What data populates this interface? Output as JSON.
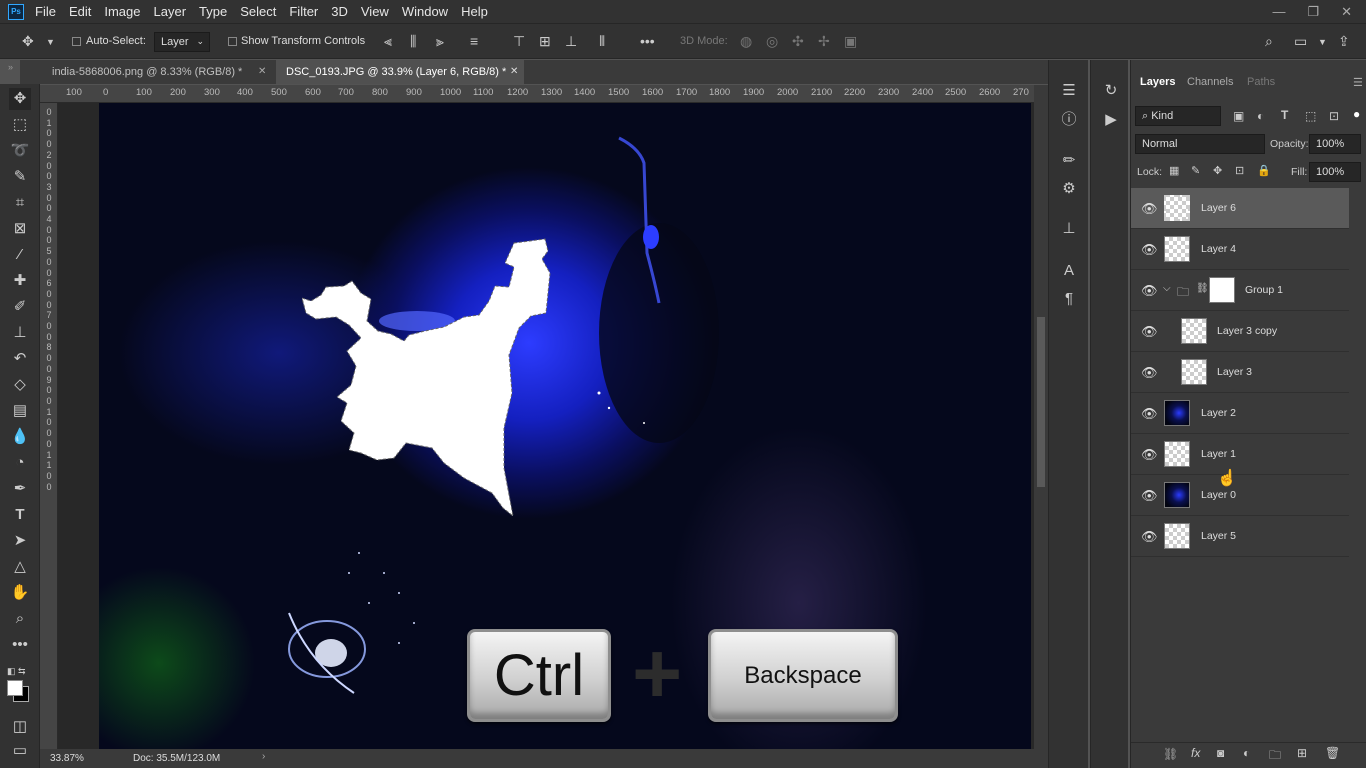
{
  "app": {
    "logo": "Ps"
  },
  "menu": [
    "File",
    "Edit",
    "Image",
    "Layer",
    "Type",
    "Select",
    "Filter",
    "3D",
    "View",
    "Window",
    "Help"
  ],
  "window_controls": {
    "minimize": "—",
    "restore": "❐",
    "close": "✕"
  },
  "options_bar": {
    "auto_select_label": "Auto-Select:",
    "auto_select_value": "Layer",
    "transform_label": "Show Transform Controls",
    "mode_3d_label": "3D Mode:"
  },
  "tabs": [
    {
      "label": "india-5868006.png @ 8.33% (RGB/8) *",
      "active": false
    },
    {
      "label": "DSC_0193.JPG @ 33.9% (Layer 6, RGB/8) *",
      "active": true
    }
  ],
  "ruler_h": [
    "100",
    "0",
    "100",
    "200",
    "300",
    "400",
    "500",
    "600",
    "700",
    "800",
    "900",
    "1000",
    "1100",
    "1200",
    "1300",
    "1400",
    "1500",
    "1600",
    "1700",
    "1800",
    "1900",
    "2000",
    "2100",
    "2200",
    "2300",
    "2400",
    "2500",
    "2600",
    "270"
  ],
  "ruler_v": [
    "0",
    "1",
    "0",
    "0",
    "2",
    "0",
    "0",
    "3",
    "0",
    "0",
    "4",
    "0",
    "0",
    "5",
    "0",
    "0",
    "6",
    "0",
    "0",
    "7",
    "0",
    "0",
    "8",
    "0",
    "0",
    "9",
    "0",
    "0",
    "1",
    "0",
    "0",
    "0",
    "1",
    "1",
    "0",
    "0"
  ],
  "status": {
    "zoom": "33.87%",
    "doc": "Doc: 35.5M/123.0M"
  },
  "panel": {
    "tabs": [
      "Layers",
      "Channels",
      "Paths"
    ],
    "filter_kind": "Kind",
    "blend_mode": "Normal",
    "opacity_label": "Opacity:",
    "opacity_value": "100%",
    "lock_label": "Lock:",
    "fill_label": "Fill:",
    "fill_value": "100%"
  },
  "layers": [
    {
      "name": "Layer 6",
      "selected": true,
      "thumb": "transparent"
    },
    {
      "name": "Layer 4",
      "selected": false,
      "thumb": "transparent"
    },
    {
      "name": "Group 1",
      "selected": false,
      "thumb": "mask",
      "group": true
    },
    {
      "name": "Layer 3 copy",
      "selected": false,
      "thumb": "transparent",
      "indent": true
    },
    {
      "name": "Layer 3",
      "selected": false,
      "thumb": "transparent",
      "indent": true
    },
    {
      "name": "Layer 2",
      "selected": false,
      "thumb": "dark"
    },
    {
      "name": "Layer 1",
      "selected": false,
      "thumb": "transparent"
    },
    {
      "name": "Layer 0",
      "selected": false,
      "thumb": "dark"
    },
    {
      "name": "Layer 5",
      "selected": false,
      "thumb": "transparent"
    }
  ],
  "overlay": {
    "key1": "Ctrl",
    "plus": "+",
    "key2": "Backspace"
  }
}
